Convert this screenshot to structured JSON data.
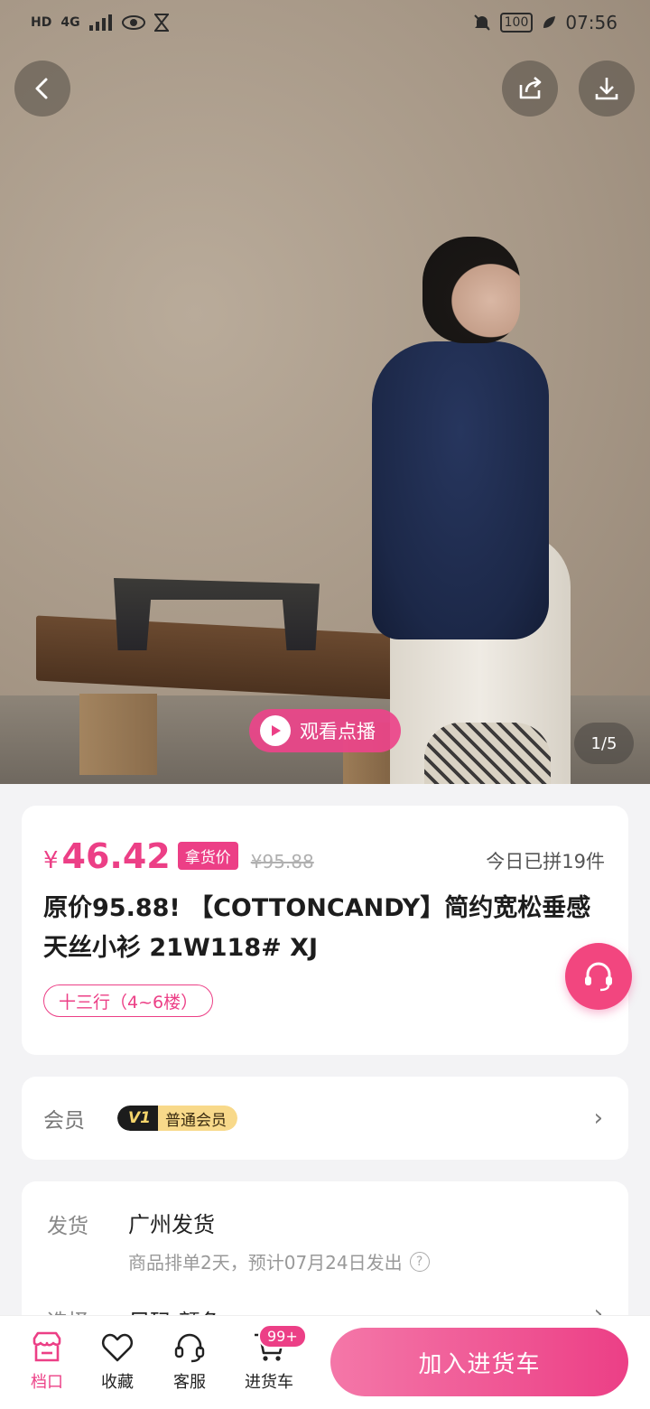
{
  "status_bar": {
    "network": "4G",
    "hd": "HD",
    "battery": "100",
    "time": "07:56"
  },
  "hero": {
    "play_label": "观看点播",
    "image_counter": "1/5"
  },
  "product": {
    "currency": "¥",
    "price": "46.42",
    "price_tag": "拿货价",
    "original_price": "¥95.88",
    "sold_today": "今日已拼19件",
    "title": "原价95.88! 【COTTONCANDY】简约宽松垂感天丝小衫  21W118#  XJ",
    "stall_tag": "十三行（4~6楼）"
  },
  "member": {
    "label": "会员",
    "level_badge": "V1",
    "level_name": "普通会员"
  },
  "shipping": {
    "label": "发货",
    "location": "广州发货",
    "note": "商品排单2天，预计07月24日发出",
    "select_label": "选择",
    "select_value": "尺码  颜色"
  },
  "bottom_nav": {
    "stall": "档口",
    "favorite": "收藏",
    "service": "客服",
    "cart": "进货车",
    "cart_badge": "99+",
    "add_to_cart": "加入进货车"
  },
  "colors": {
    "accent": "#ec3f86",
    "member_gold": "#f8d98a"
  }
}
